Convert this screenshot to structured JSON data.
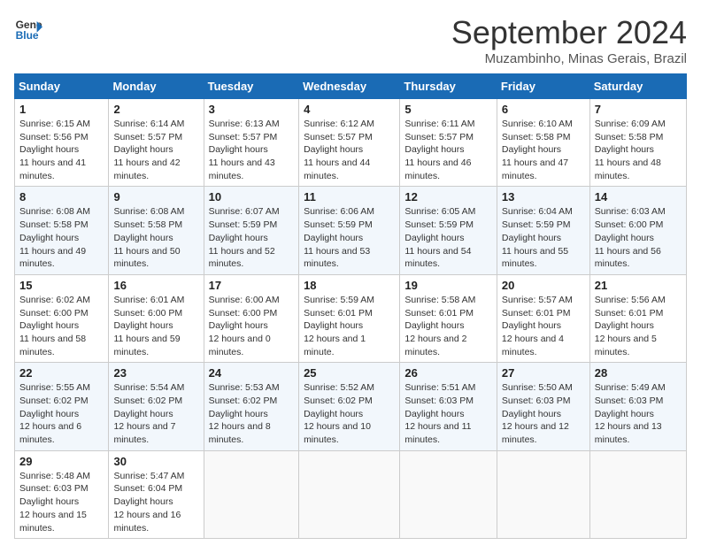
{
  "header": {
    "logo_line1": "General",
    "logo_line2": "Blue",
    "title": "September 2024",
    "subtitle": "Muzambinho, Minas Gerais, Brazil"
  },
  "weekdays": [
    "Sunday",
    "Monday",
    "Tuesday",
    "Wednesday",
    "Thursday",
    "Friday",
    "Saturday"
  ],
  "weeks": [
    [
      {
        "day": 1,
        "sunrise": "6:15 AM",
        "sunset": "5:56 PM",
        "daylight": "11 hours and 41 minutes."
      },
      {
        "day": 2,
        "sunrise": "6:14 AM",
        "sunset": "5:57 PM",
        "daylight": "11 hours and 42 minutes."
      },
      {
        "day": 3,
        "sunrise": "6:13 AM",
        "sunset": "5:57 PM",
        "daylight": "11 hours and 43 minutes."
      },
      {
        "day": 4,
        "sunrise": "6:12 AM",
        "sunset": "5:57 PM",
        "daylight": "11 hours and 44 minutes."
      },
      {
        "day": 5,
        "sunrise": "6:11 AM",
        "sunset": "5:57 PM",
        "daylight": "11 hours and 46 minutes."
      },
      {
        "day": 6,
        "sunrise": "6:10 AM",
        "sunset": "5:58 PM",
        "daylight": "11 hours and 47 minutes."
      },
      {
        "day": 7,
        "sunrise": "6:09 AM",
        "sunset": "5:58 PM",
        "daylight": "11 hours and 48 minutes."
      }
    ],
    [
      {
        "day": 8,
        "sunrise": "6:08 AM",
        "sunset": "5:58 PM",
        "daylight": "11 hours and 49 minutes."
      },
      {
        "day": 9,
        "sunrise": "6:08 AM",
        "sunset": "5:58 PM",
        "daylight": "11 hours and 50 minutes."
      },
      {
        "day": 10,
        "sunrise": "6:07 AM",
        "sunset": "5:59 PM",
        "daylight": "11 hours and 52 minutes."
      },
      {
        "day": 11,
        "sunrise": "6:06 AM",
        "sunset": "5:59 PM",
        "daylight": "11 hours and 53 minutes."
      },
      {
        "day": 12,
        "sunrise": "6:05 AM",
        "sunset": "5:59 PM",
        "daylight": "11 hours and 54 minutes."
      },
      {
        "day": 13,
        "sunrise": "6:04 AM",
        "sunset": "5:59 PM",
        "daylight": "11 hours and 55 minutes."
      },
      {
        "day": 14,
        "sunrise": "6:03 AM",
        "sunset": "6:00 PM",
        "daylight": "11 hours and 56 minutes."
      }
    ],
    [
      {
        "day": 15,
        "sunrise": "6:02 AM",
        "sunset": "6:00 PM",
        "daylight": "11 hours and 58 minutes."
      },
      {
        "day": 16,
        "sunrise": "6:01 AM",
        "sunset": "6:00 PM",
        "daylight": "11 hours and 59 minutes."
      },
      {
        "day": 17,
        "sunrise": "6:00 AM",
        "sunset": "6:00 PM",
        "daylight": "12 hours and 0 minutes."
      },
      {
        "day": 18,
        "sunrise": "5:59 AM",
        "sunset": "6:01 PM",
        "daylight": "12 hours and 1 minute."
      },
      {
        "day": 19,
        "sunrise": "5:58 AM",
        "sunset": "6:01 PM",
        "daylight": "12 hours and 2 minutes."
      },
      {
        "day": 20,
        "sunrise": "5:57 AM",
        "sunset": "6:01 PM",
        "daylight": "12 hours and 4 minutes."
      },
      {
        "day": 21,
        "sunrise": "5:56 AM",
        "sunset": "6:01 PM",
        "daylight": "12 hours and 5 minutes."
      }
    ],
    [
      {
        "day": 22,
        "sunrise": "5:55 AM",
        "sunset": "6:02 PM",
        "daylight": "12 hours and 6 minutes."
      },
      {
        "day": 23,
        "sunrise": "5:54 AM",
        "sunset": "6:02 PM",
        "daylight": "12 hours and 7 minutes."
      },
      {
        "day": 24,
        "sunrise": "5:53 AM",
        "sunset": "6:02 PM",
        "daylight": "12 hours and 8 minutes."
      },
      {
        "day": 25,
        "sunrise": "5:52 AM",
        "sunset": "6:02 PM",
        "daylight": "12 hours and 10 minutes."
      },
      {
        "day": 26,
        "sunrise": "5:51 AM",
        "sunset": "6:03 PM",
        "daylight": "12 hours and 11 minutes."
      },
      {
        "day": 27,
        "sunrise": "5:50 AM",
        "sunset": "6:03 PM",
        "daylight": "12 hours and 12 minutes."
      },
      {
        "day": 28,
        "sunrise": "5:49 AM",
        "sunset": "6:03 PM",
        "daylight": "12 hours and 13 minutes."
      }
    ],
    [
      {
        "day": 29,
        "sunrise": "5:48 AM",
        "sunset": "6:03 PM",
        "daylight": "12 hours and 15 minutes."
      },
      {
        "day": 30,
        "sunrise": "5:47 AM",
        "sunset": "6:04 PM",
        "daylight": "12 hours and 16 minutes."
      },
      null,
      null,
      null,
      null,
      null
    ]
  ]
}
